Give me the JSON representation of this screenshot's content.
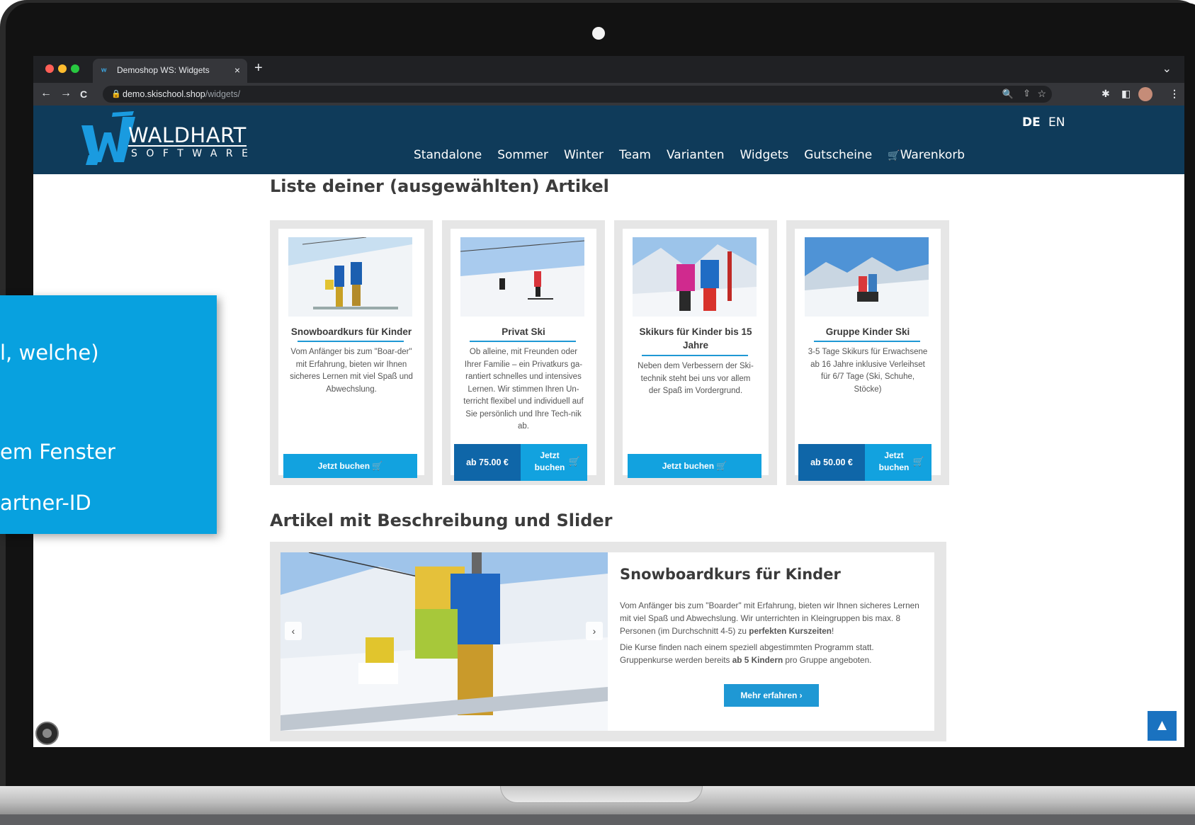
{
  "browser": {
    "tab_title": "Demoshop WS: Widgets",
    "tab_close": "×",
    "new_tab": "+",
    "tab_menu": "⌄",
    "url_host": "demo.skischool.shop",
    "url_path": "/widgets/",
    "back": "←",
    "forward": "→",
    "reload": "C",
    "lock": "🔒",
    "zoom": "🔍",
    "share": "⇧",
    "star": "☆",
    "extensions": "✱",
    "sidepanel": "◧",
    "menu": "⋮",
    "traffic_colors": [
      "#ff5f57",
      "#febc2e",
      "#28c840"
    ]
  },
  "site": {
    "brand": "WALDHART",
    "brand_sub": "SOFTWARE",
    "nav": [
      "Standalone",
      "Sommer",
      "Winter",
      "Team",
      "Varianten",
      "Widgets",
      "Gutscheine",
      "Warenkorb"
    ],
    "cart_icon": "🛒",
    "lang_de": "DE",
    "lang_en": "EN",
    "header_color": "#0f3b5a"
  },
  "section1": {
    "title": "Liste deiner (ausgewählten) Artikel",
    "cards": [
      {
        "title": "Snowboardkurs für Kinder",
        "desc": "Vom Anfänger bis zum \"Boar-der\" mit Erfahrung, bieten wir Ihnen sicheres Lernen mit viel Spaß und Abwechslung.",
        "button": "Jetzt buchen 🛒"
      },
      {
        "title": "Privat Ski",
        "desc": "Ob alleine, mit Freunden oder Ihrer Familie – ein Privatkurs ga-rantiert schnelles und intensives Lernen. Wir stimmen Ihren Un-terricht flexibel und individuell auf Sie persönlich und Ihre Tech-nik ab.",
        "price": "ab 75.00 €",
        "book": "Jetzt buchen"
      },
      {
        "title": "Skikurs für Kinder bis 15 Jahre",
        "desc": "Neben dem Verbessern der Ski-technik steht bei uns vor allem der Spaß im Vordergrund.",
        "button": "Jetzt buchen 🛒"
      },
      {
        "title": "Gruppe Kinder Ski",
        "desc": "3-5 Tage Skikurs für Erwachsene ab 16 Jahre inklusive Verleihset für 6/7 Tage (Ski, Schuhe, Stöcke)",
        "price": "ab 50.00 €",
        "book": "Jetzt buchen"
      }
    ]
  },
  "section2": {
    "title": "Artikel mit Beschreibung und Slider",
    "item_title": "Snowboardkurs für Kinder",
    "p1_a": "Vom Anfänger bis zum \"Boarder\" mit Erfahrung, bieten wir Ihnen sicheres Lernen mit viel Spaß und Abwechslung. Wir unterrichten in Kleingruppen bis max. 8 Personen (im Durchschnitt 4-5) zu ",
    "p1_b": "perfekten Kurszeiten",
    "p1_c": "!",
    "p2_a": "Die Kurse finden nach einem speziell abgestimmten Programm statt. Gruppenkurse werden bereits ",
    "p2_b": "ab 5 Kindern",
    "p2_c": " pro Gruppe angeboten.",
    "more_button": "Mehr erfahren ›",
    "prev": "‹",
    "next": "›"
  },
  "overlay": {
    "lines": [
      "l, welche)",
      "em Fenster",
      "artner-ID"
    ],
    "color": "#08a1df"
  },
  "scroll_top": "▲"
}
